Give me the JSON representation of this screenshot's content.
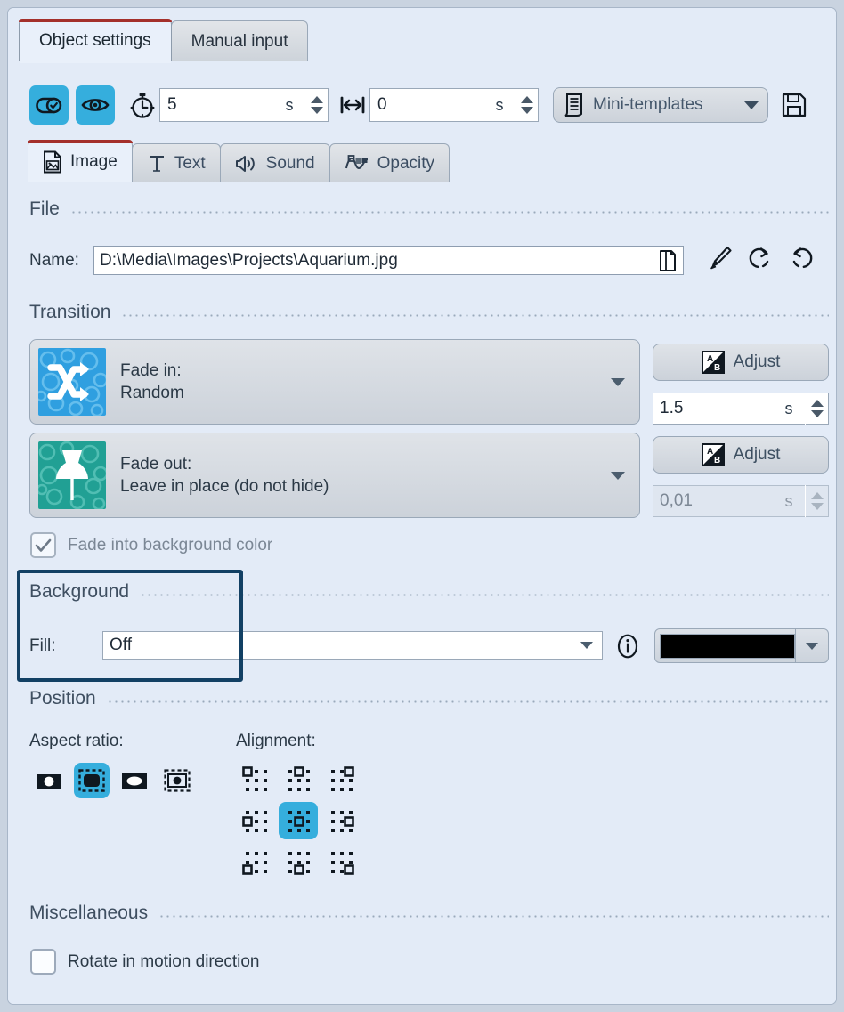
{
  "window": {
    "top_tabs": [
      {
        "label": "Object settings",
        "active": true
      },
      {
        "label": "Manual input",
        "active": false
      }
    ]
  },
  "toolbar": {
    "toggle_show_label": "toggle-switch",
    "visibility_label": "eye",
    "duration": {
      "icon": "stopwatch-icon",
      "value": "5",
      "unit": "s"
    },
    "delay": {
      "icon": "horizontal-arrows-icon",
      "value": "0",
      "unit": "s"
    },
    "mini_templates": {
      "label": "Mini-templates",
      "icon": "list-document-icon"
    },
    "save_icon": "floppy-disk-icon"
  },
  "sub_tabs": [
    {
      "label": "Image",
      "icon": "image-file-icon",
      "active": true
    },
    {
      "label": "Text",
      "icon": "text-T-icon",
      "active": false
    },
    {
      "label": "Sound",
      "icon": "speaker-icon",
      "active": false
    },
    {
      "label": "Opacity",
      "icon": "opacity-curve-icon",
      "active": false
    }
  ],
  "file_section": {
    "title": "File",
    "name_label": "Name:",
    "name_value": "D:\\Media\\Images\\Projects\\Aquarium.jpg",
    "browse_icon": "folder-open-icon",
    "tools": [
      {
        "icon": "paintbrush-icon",
        "name": "edit-image-button"
      },
      {
        "icon": "rotate-left-icon",
        "name": "rotate-left-button"
      },
      {
        "icon": "rotate-right-icon",
        "name": "rotate-right-button"
      }
    ]
  },
  "transition_section": {
    "title": "Transition",
    "fade_in": {
      "label": "Fade in:",
      "value": "Random",
      "thumb_color": "#2f9fe0",
      "thumb_icon": "shuffle-icon",
      "adjust_label": "Adjust",
      "duration": "1.5",
      "unit": "s",
      "disabled": false
    },
    "fade_out": {
      "label": "Fade out:",
      "value": "Leave in place (do not hide)",
      "thumb_color": "#21a094",
      "thumb_icon": "pushpin-icon",
      "adjust_label": "Adjust",
      "duration": "0,01",
      "unit": "s",
      "disabled": true
    },
    "fade_into_bg": {
      "label": "Fade into background color",
      "checked": true,
      "disabled": true
    }
  },
  "background_section": {
    "title": "Background",
    "fill_label": "Fill:",
    "fill_value": "Off",
    "info_icon": "info-icon",
    "color_value": "#000000",
    "highlight_color": "#124064"
  },
  "position_section": {
    "title": "Position",
    "aspect_ratio_label": "Aspect ratio:",
    "aspect_ratio_options": [
      {
        "name": "aspect-ratio-original",
        "selected": false
      },
      {
        "name": "aspect-ratio-fit",
        "selected": true
      },
      {
        "name": "aspect-ratio-fill",
        "selected": false
      },
      {
        "name": "aspect-ratio-stretch",
        "selected": false
      }
    ],
    "alignment_label": "Alignment:",
    "alignment_options": [
      {
        "name": "align-top-left",
        "selected": false
      },
      {
        "name": "align-top-center",
        "selected": false
      },
      {
        "name": "align-top-right",
        "selected": false
      },
      {
        "name": "align-middle-left",
        "selected": false
      },
      {
        "name": "align-middle-center",
        "selected": true
      },
      {
        "name": "align-middle-right",
        "selected": false
      },
      {
        "name": "align-bottom-left",
        "selected": false
      },
      {
        "name": "align-bottom-center",
        "selected": false
      },
      {
        "name": "align-bottom-right",
        "selected": false
      }
    ]
  },
  "misc_section": {
    "title": "Miscellaneous",
    "rotate_label": "Rotate in motion direction",
    "rotate_checked": false
  },
  "colors": {
    "accent": "#35aedd",
    "tab_accent": "#a4302b",
    "panel_bg": "#e3ebf7",
    "outer_bg": "#c9d3e0"
  }
}
